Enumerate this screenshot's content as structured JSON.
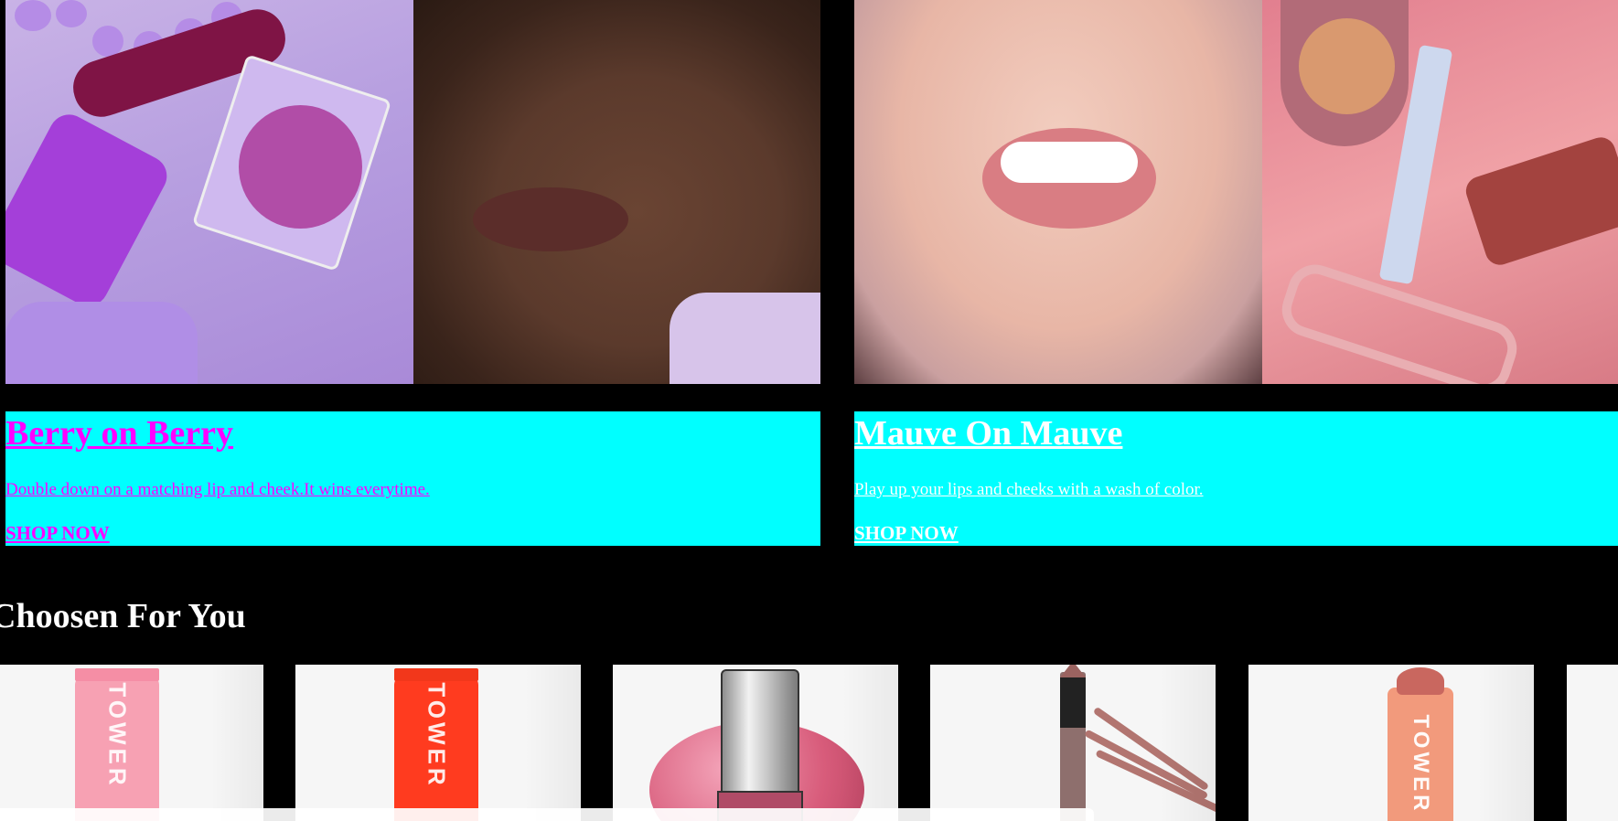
{
  "promos": [
    {
      "title": "Berry on Berry",
      "description": "Double down on a matching lip and cheek.It wins everytime.",
      "cta": "SHOP NOW"
    },
    {
      "title": "Mauve On Mauve",
      "description": "Play up your lips and cheeks with a wash of color.",
      "cta": "SHOP NOW"
    }
  ],
  "section": {
    "title": "Choosen For You"
  },
  "products": [
    {
      "brand": "TOWER",
      "image": "pink lip tube"
    },
    {
      "brand": "TOWER",
      "image": "red lip tube"
    },
    {
      "brand": "",
      "image": "pink nail polish"
    },
    {
      "brand": "",
      "image": "nude lip pencil"
    },
    {
      "brand": "TOWER",
      "image": "peach lip crayon"
    },
    {
      "brand": "",
      "image": "partially visible product"
    }
  ],
  "notice": {
    "text": ""
  },
  "colors": {
    "page_background": "#000000",
    "promo_panel": "#00ffff",
    "promo1_text": "#ff00ff",
    "promo2_text": "#ffffff",
    "section_title": "#ffffff"
  }
}
